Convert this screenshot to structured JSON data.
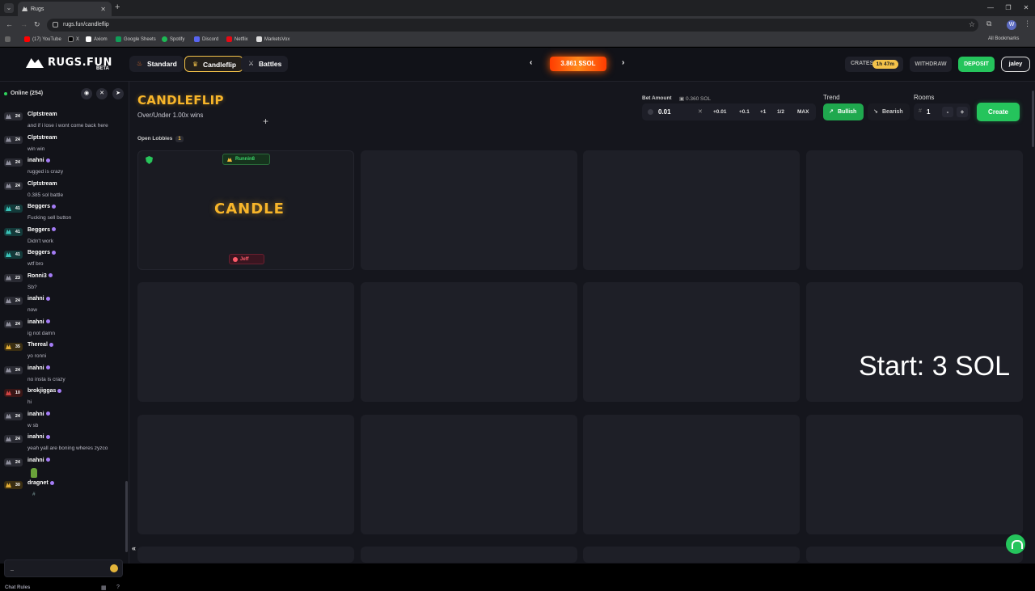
{
  "browser": {
    "tab_title": "Rugs",
    "url": "rugs.fun/candleflip",
    "profile_initial": "W",
    "bookmarks": [
      "(17) YouTube",
      "X",
      "Axiom",
      "Google Sheets",
      "Spotify",
      "Discord",
      "Netflix",
      "MarketsVox"
    ],
    "all_bookmarks": "All Bookmarks"
  },
  "header": {
    "logo_text": "RUGS.FUN",
    "logo_badge": "BETA",
    "tabs": [
      {
        "label": "Standard",
        "icon": "flame-icon",
        "active": false
      },
      {
        "label": "Candleflip",
        "icon": "crown-icon",
        "active": true
      },
      {
        "label": "Battles",
        "icon": "swords-icon",
        "active": false
      }
    ],
    "jackpot": "3.861 $SOL",
    "crates_label": "CRATES",
    "crates_timer": "1h 47m",
    "withdraw_label": "WITHDRAW",
    "deposit_label": "DEPOSIT",
    "username": "jaley"
  },
  "sidebar": {
    "online": "Online (254)",
    "chat_rules": "Chat Rules",
    "input_value": "_",
    "messages": [
      {
        "level": "24",
        "tier": "grey",
        "user": "Clptstream",
        "verified": false,
        "text": "and if i lose i wont come back here"
      },
      {
        "level": "24",
        "tier": "grey",
        "user": "Clptstream",
        "verified": false,
        "text": "win win"
      },
      {
        "level": "24",
        "tier": "grey",
        "user": "inahni",
        "verified": true,
        "text": "rugged is crazy"
      },
      {
        "level": "24",
        "tier": "grey",
        "user": "Clptstream",
        "verified": false,
        "text": "0.385 sol battle"
      },
      {
        "level": "41",
        "tier": "teal",
        "user": "Beggers",
        "verified": true,
        "text": "Fucking sell button"
      },
      {
        "level": "41",
        "tier": "teal",
        "user": "Beggers",
        "verified": true,
        "text": "Didn't work"
      },
      {
        "level": "41",
        "tier": "teal",
        "user": "Beggers",
        "verified": true,
        "text": "wtf bro"
      },
      {
        "level": "23",
        "tier": "grey",
        "user": "Ronni3",
        "verified": true,
        "text": "Sb?"
      },
      {
        "level": "24",
        "tier": "grey",
        "user": "inahni",
        "verified": true,
        "text": "now"
      },
      {
        "level": "24",
        "tier": "grey",
        "user": "inahni",
        "verified": true,
        "text": "ig not damn"
      },
      {
        "level": "35",
        "tier": "gold",
        "user": "Thereal",
        "verified": true,
        "text": "yo ronni"
      },
      {
        "level": "24",
        "tier": "grey",
        "user": "inahni",
        "verified": true,
        "text": "no insta is crazy"
      },
      {
        "level": "10",
        "tier": "red",
        "user": "brokjiggas",
        "verified": true,
        "text": "hi"
      },
      {
        "level": "24",
        "tier": "grey",
        "user": "inahni",
        "verified": true,
        "text": "w sb"
      },
      {
        "level": "24",
        "tier": "grey",
        "user": "inahni",
        "verified": true,
        "text": "yeah yall are boning wheres zyzco"
      },
      {
        "level": "24",
        "tier": "grey",
        "user": "inahni",
        "verified": true,
        "text": ""
      },
      {
        "level": "30",
        "tier": "gold",
        "user": "dragnet",
        "verified": true,
        "text": "#"
      }
    ]
  },
  "main": {
    "title": "CANDLEFLIP",
    "subtitle": "Over/Under 1.00x wins",
    "open_lobbies_label": "Open Lobbies",
    "open_lobbies_count": "1",
    "bet_amount_label": "Bet Amount",
    "bet_balance": "0.360 SOL",
    "bet_value": "0.01",
    "quick_bets": [
      "+0.01",
      "+0.1",
      "+1",
      "1/2",
      "MAX"
    ],
    "trend_label": "Trend",
    "bullish_label": "Bullish",
    "bearish_label": "Bearish",
    "rooms_label": "Rooms",
    "rooms_value": "1",
    "rooms_minus": "-",
    "rooms_plus": "+",
    "create_label": "Create",
    "lobby": {
      "runner_label": "Runnin8",
      "game_label": "CANDLE",
      "bettor_label": "Jeff"
    },
    "overlay_text": "Start: 3 SOL"
  },
  "colors": {
    "accent_gold": "#f7b52a",
    "accent_green": "#25c45c",
    "bearish_red": "#ff5b6a",
    "background": "#15161d"
  }
}
